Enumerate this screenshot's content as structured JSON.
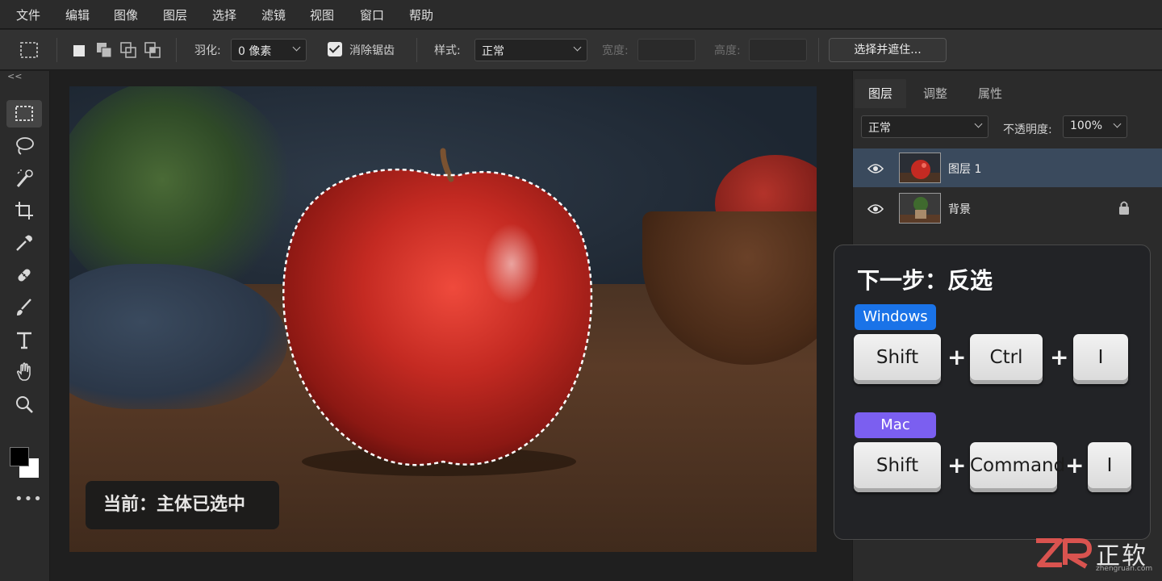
{
  "menu": {
    "items": [
      "文件",
      "编辑",
      "图像",
      "图层",
      "选择",
      "滤镜",
      "视图",
      "窗口",
      "帮助"
    ]
  },
  "options": {
    "feather_label": "羽化:",
    "feather_value": "0 像素",
    "antialias_label": "消除锯齿",
    "antialias_checked": true,
    "style_label": "样式:",
    "style_value": "正常",
    "width_label": "宽度:",
    "height_label": "高度:",
    "select_mask_label": "选择并遮住..."
  },
  "toolbar": {
    "collapse": "<<",
    "tools": [
      "rect-marquee-icon",
      "lasso-icon",
      "quick-select-icon",
      "crop-icon",
      "eyedropper-icon",
      "healing-bandage-icon",
      "brush-icon",
      "type-icon",
      "hand-icon",
      "zoom-icon"
    ],
    "active_tool": "rect-marquee-icon",
    "foreground_color": "#000000",
    "background_color": "#ffffff",
    "more": "•••"
  },
  "canvas": {
    "status_text": "当前：主体已选中"
  },
  "panel": {
    "tabs": [
      "图层",
      "调整",
      "属性"
    ],
    "active_tab": "图层",
    "blend_mode": "正常",
    "opacity_label": "不透明度:",
    "opacity_value": "100%",
    "layers": [
      {
        "name": "图层 1",
        "selected": true,
        "locked": false
      },
      {
        "name": "背景",
        "selected": false,
        "locked": true
      }
    ]
  },
  "shortcut_card": {
    "title": "下一步：反选",
    "windows": {
      "label": "Windows",
      "color": "#1a73e8",
      "keys": [
        "Shift",
        "Ctrl",
        "I"
      ]
    },
    "mac": {
      "label": "Mac",
      "color": "#7b5ff0",
      "keys": [
        "Shift",
        "Command",
        "I"
      ]
    },
    "plus": "+"
  },
  "watermark": {
    "logo": "ZR",
    "text": "正软",
    "sub": "zhengruan.com",
    "logo_color": "#d9534f"
  }
}
